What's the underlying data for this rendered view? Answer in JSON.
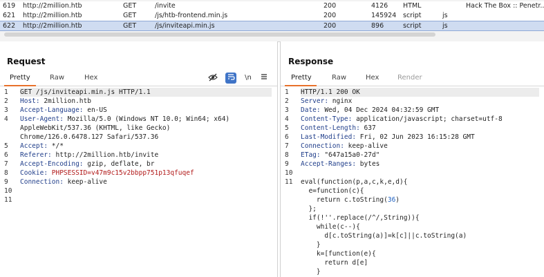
{
  "history": {
    "rows": [
      {
        "num": "619",
        "host": "http://2million.htb",
        "method": "GET",
        "path": "/invite",
        "status": "200",
        "length": "4126",
        "mime": "HTML",
        "ext": "",
        "title": "Hack The Box :: Penetr..."
      },
      {
        "num": "621",
        "host": "http://2million.htb",
        "method": "GET",
        "path": "/js/htb-frontend.min.js",
        "status": "200",
        "length": "145924",
        "mime": "script",
        "ext": "js",
        "title": ""
      },
      {
        "num": "622",
        "host": "http://2million.htb",
        "method": "GET",
        "path": "/js/inviteapi.min.js",
        "status": "200",
        "length": "896",
        "mime": "script",
        "ext": "js",
        "title": ""
      }
    ]
  },
  "request": {
    "title": "Request",
    "tabs": [
      "Pretty",
      "Raw",
      "Hex"
    ],
    "tools": {
      "eye": "eye-slash-icon",
      "wrap": "wrap-icon",
      "newline": "\\n",
      "menu": "menu-icon"
    },
    "line_numbers": [
      "1",
      "2",
      "3",
      "4",
      "5",
      "6",
      "7",
      "8",
      "9",
      "10",
      "11"
    ],
    "lines": {
      "l1": "GET /js/inviteapi.min.js HTTP/1.1",
      "l2k": "Host:",
      "l2v": " 2million.htb",
      "l3k": "Accept-Language:",
      "l3v": " en-US",
      "l4k": "User-Agent:",
      "l4v": " Mozilla/5.0 (Windows NT 10.0; Win64; x64)",
      "l4b": "AppleWebKit/537.36 (KHTML, like Gecko)",
      "l4c": "Chrome/126.0.6478.127 Safari/537.36",
      "l5k": "Accept:",
      "l5v": " */*",
      "l6k": "Referer:",
      "l6v": " http://2million.htb/invite",
      "l7k": "Accept-Encoding:",
      "l7v": " gzip, deflate, br",
      "l8k": "Cookie:",
      "l8c": " PHPSESSID",
      "l8v": "=v47m9c15v2bbpp751p13qfuqef",
      "l9k": "Connection:",
      "l9v": " keep-alive"
    }
  },
  "response": {
    "title": "Response",
    "tabs": [
      "Pretty",
      "Raw",
      "Hex",
      "Render"
    ],
    "line_numbers": [
      "1",
      "2",
      "3",
      "4",
      "5",
      "6",
      "7",
      "8",
      "9",
      "10",
      "11"
    ],
    "lines": {
      "l1": "HTTP/1.1 200 OK",
      "l2k": "Server:",
      "l2v": " nginx",
      "l3k": "Date:",
      "l3v": " Wed, 04 Dec 2024 04:32:59 GMT",
      "l4k": "Content-Type:",
      "l4v": " application/javascript; charset=utf-8",
      "l5k": "Content-Length:",
      "l5v": " 637",
      "l6k": "Last-Modified:",
      "l6v": " Fri, 02 Jun 2023 16:15:28 GMT",
      "l7k": "Connection:",
      "l7v": " keep-alive",
      "l8k": "ETag:",
      "l8v": " \"647a15a0-27d\"",
      "l9k": "Accept-Ranges:",
      "l9v": " bytes",
      "c1": "eval(function(p,a,c,k,e,d){",
      "c2a": "  e=function(c){",
      "c3a": "    return c.toString(",
      "c3n": "36",
      "c3b": ")",
      "c4": "  };",
      "c5a": "  if(!''.replace(/^/,String)){",
      "c6a": "    while(c--){",
      "c7": "      d[c.toString(a)]=k[c]||c.toString(a)",
      "c8": "    }",
      "c9a": "    k=[function(e){",
      "c10": "      return d[e]",
      "c11": "    }"
    }
  }
}
